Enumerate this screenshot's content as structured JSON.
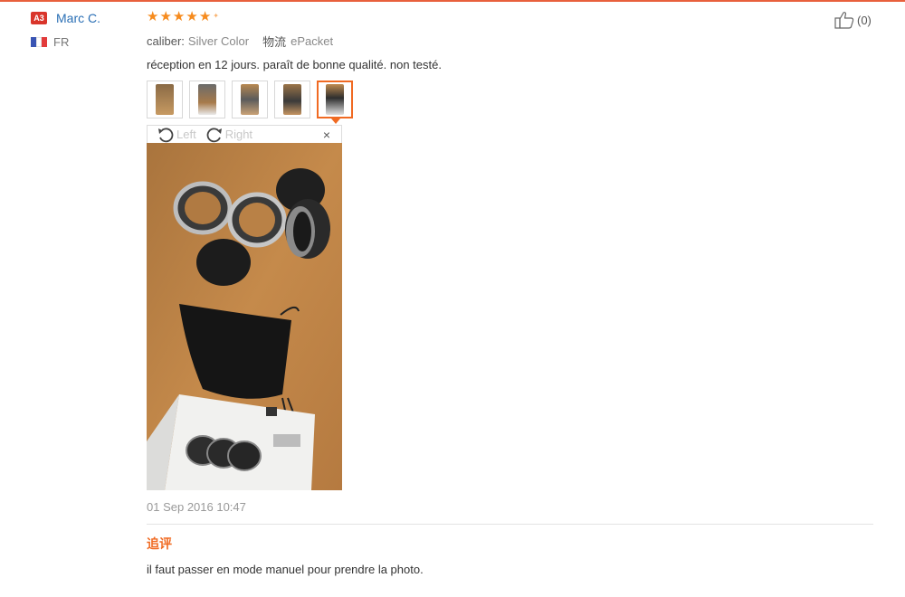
{
  "user": {
    "level": "A3",
    "name": "Marc C.",
    "country": "FR",
    "flag_colors": [
      "#3a55b4",
      "#ffffff",
      "#e23b3b"
    ]
  },
  "review": {
    "rating": 5,
    "attributes": {
      "color_key": "caliber:",
      "color_value": "Silver Color",
      "logistics_key": "物流",
      "logistics_value": "ePacket"
    },
    "text": "réception en 12 jours. paraît de bonne qualité. non testé.",
    "thumbnail_count": 5,
    "active_thumbnail": 5,
    "viewer": {
      "rotate_left_label": "Left",
      "rotate_right_label": "Right",
      "close_glyph": "×"
    },
    "date": "01 Sep 2016 10:47",
    "followup_title": "追评",
    "followup_text": "il faut passer en mode manuel pour prendre la photo."
  },
  "helpful": {
    "count": "(0)",
    "icon": "thumbs-up-icon"
  },
  "colors": {
    "accent": "#f06a22",
    "star": "#f68b1e",
    "link": "#2a6fb5",
    "badge": "#d9352b"
  }
}
